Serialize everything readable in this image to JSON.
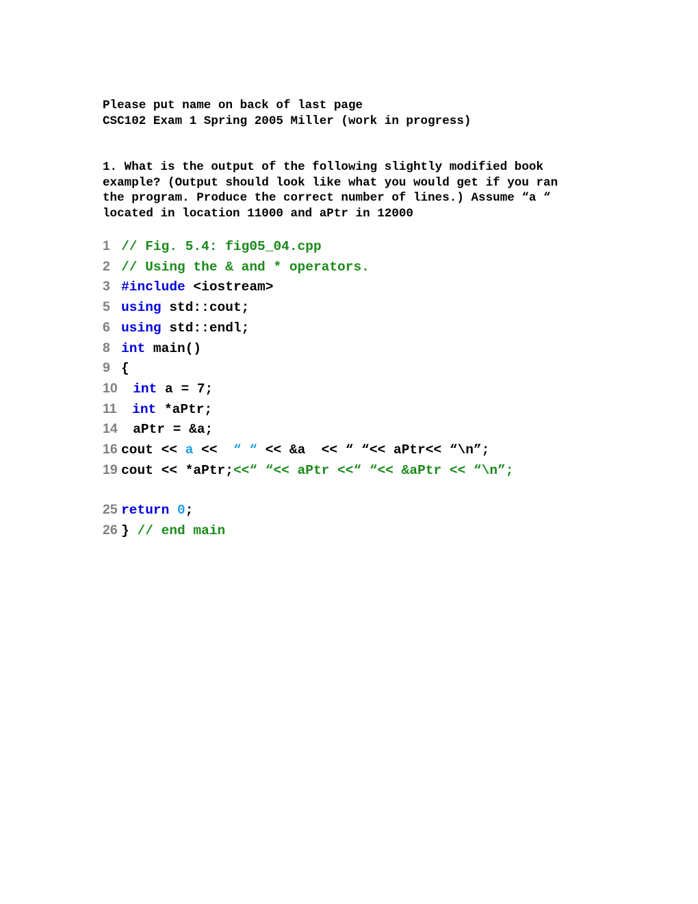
{
  "document": {
    "header": {
      "line1": "Please put name on back of last page",
      "line2": "CSC102 Exam 1 Spring 2005 Miller (work in progress)"
    },
    "question": {
      "text": "1. What is the output of the following slightly modified book example? (Output should look like what you would get if you ran the program. Produce the correct number of lines.) Assume “a “ located in location 11000 and aPtr in 12000"
    },
    "colors": {
      "comment_green": "#1a8a1a",
      "keyword_blue": "#0000dd",
      "literal_azure": "#1e9fe8",
      "lineno_gray": "#808080",
      "text_black": "#000000",
      "page_background": "#ffffff"
    },
    "code_listing": {
      "lines": [
        {
          "number": "1",
          "gutter": "1   ",
          "segments": [
            {
              "text": "// Fig. 5.4: fig05_04.cpp",
              "style": "cm"
            }
          ]
        },
        {
          "number": "2",
          "gutter": "2   ",
          "segments": [
            {
              "text": "// Using the & and * operators.",
              "style": "cm"
            }
          ]
        },
        {
          "number": "3",
          "gutter": "3   ",
          "segments": [
            {
              "text": "#include",
              "style": "kw"
            },
            {
              "text": " <iostream>",
              "style": "pl"
            }
          ]
        },
        {
          "number": "5",
          "gutter": "5   ",
          "segments": [
            {
              "text": "using",
              "style": "kw"
            },
            {
              "text": " std::cout;",
              "style": "pl"
            }
          ]
        },
        {
          "number": "6",
          "gutter": "6   ",
          "segments": [
            {
              "text": "using",
              "style": "kw"
            },
            {
              "text": " std::endl;",
              "style": "pl"
            }
          ]
        },
        {
          "number": "8",
          "gutter": "8   ",
          "segments": [
            {
              "text": "int",
              "style": "kw"
            },
            {
              "text": " main()",
              "style": "pl"
            }
          ]
        },
        {
          "number": "9",
          "gutter": "9   ",
          "segments": [
            {
              "text": "{",
              "style": "pl"
            }
          ]
        },
        {
          "number": "10",
          "gutter": "10  ",
          "segments": [
            {
              "text": " ",
              "style": "pl"
            },
            {
              "text": "int",
              "style": "kw"
            },
            {
              "text": " a = 7;",
              "style": "pl"
            }
          ]
        },
        {
          "number": "11",
          "gutter": "11  ",
          "segments": [
            {
              "text": " ",
              "style": "pl"
            },
            {
              "text": "int",
              "style": "kw"
            },
            {
              "text": " *aPtr;",
              "style": "pl"
            }
          ]
        },
        {
          "number": "14",
          "gutter": "14  ",
          "segments": [
            {
              "text": " aPtr = &a;",
              "style": "pl"
            }
          ]
        },
        {
          "number": "16",
          "gutter": "16 ",
          "segments": [
            {
              "text": "cout << ",
              "style": "pl"
            },
            {
              "text": "a",
              "style": "lit"
            },
            {
              "text": " << ",
              "style": "pl"
            },
            {
              "text": " “ “",
              "style": "lit"
            },
            {
              "text": " << &a  << “ “<< aPtr<< “\\n”;",
              "style": "pl"
            }
          ]
        },
        {
          "number": "19",
          "gutter": "19 ",
          "segments": [
            {
              "text": "cout << *aPtr;",
              "style": "pl"
            },
            {
              "text": "<<“ “<< aPtr <<“ “<< &aPtr << “\\n”;",
              "style": "cm"
            }
          ]
        },
        {
          "number": "",
          "gutter": "",
          "blank": true,
          "segments": []
        },
        {
          "number": "25",
          "gutter": "25 ",
          "segments": [
            {
              "text": "return",
              "style": "kw"
            },
            {
              "text": " ",
              "style": "pl"
            },
            {
              "text": "0",
              "style": "lit"
            },
            {
              "text": ";",
              "style": "pl"
            }
          ]
        },
        {
          "number": "26",
          "gutter": "26 ",
          "segments": [
            {
              "text": "} ",
              "style": "pl"
            },
            {
              "text": "// end main",
              "style": "cm"
            }
          ]
        }
      ]
    }
  }
}
